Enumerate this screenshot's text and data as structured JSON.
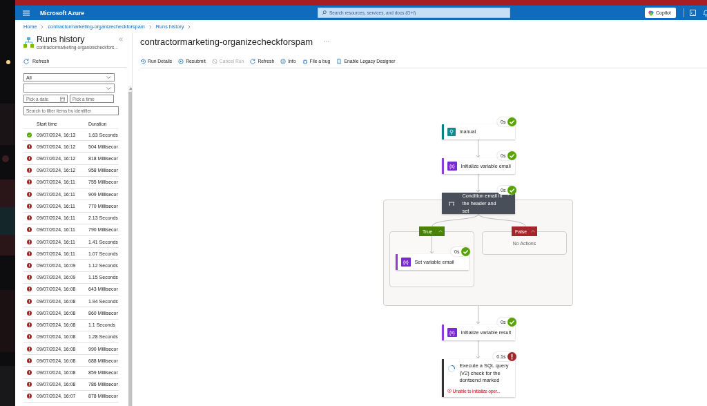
{
  "top_bar": {
    "brand": "Microsoft Azure",
    "search": {
      "placeholder": "Search resources, services, and docs (G+/)"
    },
    "copilot": "Copilot"
  },
  "breadcrumb": [
    "Home",
    "contractormarketing-organizecheckforspam",
    "Runs history"
  ],
  "runs_panel": {
    "title": "Runs history",
    "subtitle": "contractormarketing-organizecheckfors...",
    "refresh": "Refresh",
    "status_filter": {
      "value": "All"
    },
    "date": {
      "placeholder": "Pick a date"
    },
    "time": {
      "placeholder": "Pick a time"
    },
    "search": {
      "placeholder": "Search to filter items by identifier"
    },
    "columns": [
      "Start time",
      "Duration"
    ],
    "rows": [
      {
        "failed": false,
        "start": "09/07/2024, 16:13",
        "duration": "1.63 Seconds"
      },
      {
        "failed": true,
        "start": "09/07/2024, 16:12",
        "duration": "504 Millisecor"
      },
      {
        "failed": true,
        "start": "09/07/2024, 16:12",
        "duration": "818 Millisecor"
      },
      {
        "failed": true,
        "start": "09/07/2024, 16:12",
        "duration": "958 Millisecor"
      },
      {
        "failed": true,
        "start": "09/07/2024, 16:11",
        "duration": "755 Millisecor"
      },
      {
        "failed": true,
        "start": "09/07/2024, 16:11",
        "duration": "909 Millisecor"
      },
      {
        "failed": true,
        "start": "09/07/2024, 16:11",
        "duration": "770 Millisecor"
      },
      {
        "failed": true,
        "start": "09/07/2024, 16:11",
        "duration": "2.13 Seconds"
      },
      {
        "failed": true,
        "start": "09/07/2024, 16:11",
        "duration": "790 Millisecor"
      },
      {
        "failed": true,
        "start": "09/07/2024, 16:11",
        "duration": "1.41 Seconds"
      },
      {
        "failed": true,
        "start": "09/07/2024, 16:11",
        "duration": "1.07 Seconds"
      },
      {
        "failed": true,
        "start": "09/07/2024, 16:09",
        "duration": "1.12 Seconds"
      },
      {
        "failed": true,
        "start": "09/07/2024, 16:09",
        "duration": "1.15 Seconds"
      },
      {
        "failed": true,
        "start": "09/07/2024, 16:08",
        "duration": "643 Millisecor"
      },
      {
        "failed": true,
        "start": "09/07/2024, 16:08",
        "duration": "1.94 Seconds"
      },
      {
        "failed": true,
        "start": "09/07/2024, 16:08",
        "duration": "860 Millisecor"
      },
      {
        "failed": true,
        "start": "09/07/2024, 16:08",
        "duration": "1.1 Seconds"
      },
      {
        "failed": true,
        "start": "09/07/2024, 16:08",
        "duration": "1.28 Seconds"
      },
      {
        "failed": true,
        "start": "09/07/2024, 16:08",
        "duration": "990 Millisecor"
      },
      {
        "failed": true,
        "start": "09/07/2024, 16:08",
        "duration": "688 Millisecor"
      },
      {
        "failed": true,
        "start": "09/07/2024, 16:08",
        "duration": "859 Millisecor"
      },
      {
        "failed": true,
        "start": "09/07/2024, 16:08",
        "duration": "786 Millisecor"
      },
      {
        "failed": true,
        "start": "09/07/2024, 16:07",
        "duration": "878 Millisecor"
      }
    ]
  },
  "main": {
    "title": "contractormarketing-organizecheckforspam",
    "toolbar": [
      {
        "kind": "history",
        "label": "Run Details",
        "disabled": false
      },
      {
        "kind": "resubmit",
        "label": "Resubmit",
        "disabled": false
      },
      {
        "kind": "cancel",
        "label": "Cancel Run",
        "disabled": true
      },
      {
        "kind": "refresh",
        "label": "Refresh",
        "disabled": false
      },
      {
        "kind": "info",
        "label": "Info",
        "disabled": false
      },
      {
        "kind": "bug",
        "label": "File a bug",
        "disabled": false
      },
      {
        "kind": "bookmark",
        "label": "Enable Legacy Designer",
        "disabled": false
      }
    ],
    "flow": [
      {
        "kind": "trigger",
        "label": "manual",
        "duration": "0s",
        "failed": false
      },
      {
        "kind": "variable",
        "icon_text": "{x}",
        "label": "Initialize variable email",
        "duration": "0s",
        "failed": false
      },
      {
        "kind": "condition",
        "label": "Condition email in the header and set",
        "duration": "0s",
        "failed": false,
        "branches": [
          {
            "kind": "true",
            "label": "True",
            "steps": [
              {
                "kind": "variable",
                "icon_text": "{x}",
                "label": "Set variable email",
                "duration": "0s",
                "failed": false
              }
            ]
          },
          {
            "kind": "false",
            "label": "False",
            "empty_text": "No Actions"
          }
        ]
      },
      {
        "kind": "variable",
        "icon_text": "{x}",
        "label": "Initialize variable result",
        "duration": "0s",
        "failed": false
      },
      {
        "kind": "sql",
        "label": "Execute a SQL query (V2) check for the dontsend marked",
        "duration": "0.1s",
        "failed": true,
        "error": "Unable to initialize oper..."
      }
    ]
  }
}
